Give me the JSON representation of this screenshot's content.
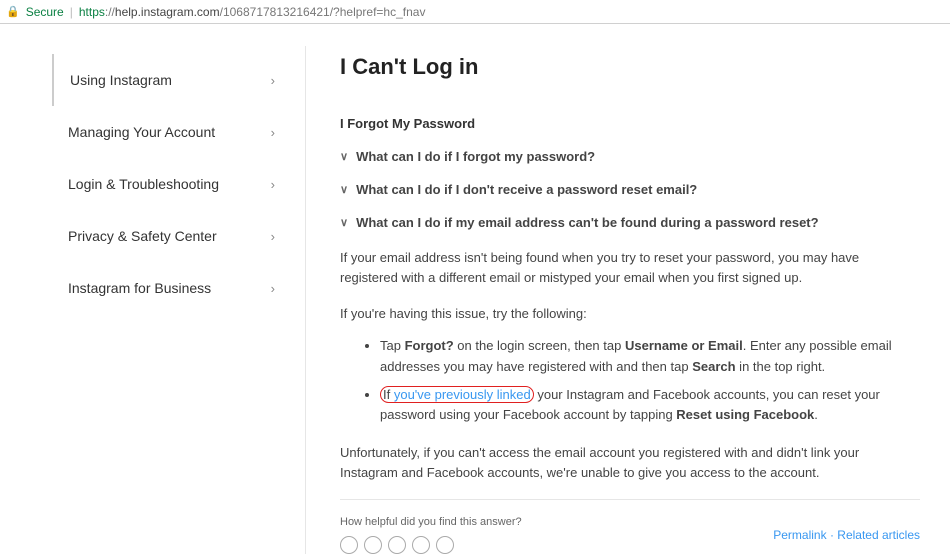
{
  "address_bar": {
    "secure_label": "Secure",
    "url_https": "https",
    "url_sep": "://",
    "url_domain": "help.instagram.com",
    "url_path": "/1068717813216421/?helpref=hc_fnav"
  },
  "sidebar": {
    "items": [
      {
        "label": "Using Instagram"
      },
      {
        "label": "Managing Your Account"
      },
      {
        "label": "Login & Troubleshooting"
      },
      {
        "label": "Privacy & Safety Center"
      },
      {
        "label": "Instagram for Business"
      }
    ]
  },
  "main": {
    "title": "I Can't Log in",
    "section_title": "I Forgot My Password",
    "accordion1": "What can I do if I forgot my password?",
    "accordion2": "What can I do if I don't receive a password reset email?",
    "accordion3": "What can I do if my email address can't be found during a password reset?",
    "para1": "If your email address isn't being found when you try to reset your password, you may have registered with a different email or mistyped your email when you first signed up.",
    "para2": "If you're having this issue, try the following:",
    "li1_a": "Tap ",
    "li1_b": "Forgot?",
    "li1_c": " on the login screen, then tap ",
    "li1_d": "Username or Email",
    "li1_e": ". Enter any possible email addresses you may have registered with and then tap ",
    "li1_f": "Search",
    "li1_g": " in the top right.",
    "li2_a": "If ",
    "li2_link": "you've previously linked",
    "li2_b": " your Instagram and Facebook accounts, you can reset your password using your Facebook account by tapping ",
    "li2_c": "Reset using Facebook",
    "li2_d": ".",
    "para3": "Unfortunately, if you can't access the email account you registered with and didn't link your Instagram and Facebook accounts, we're unable to give you access to the account.",
    "helpful_label": "How helpful did you find this answer?",
    "permalink": "Permalink",
    "related": "Related articles"
  }
}
